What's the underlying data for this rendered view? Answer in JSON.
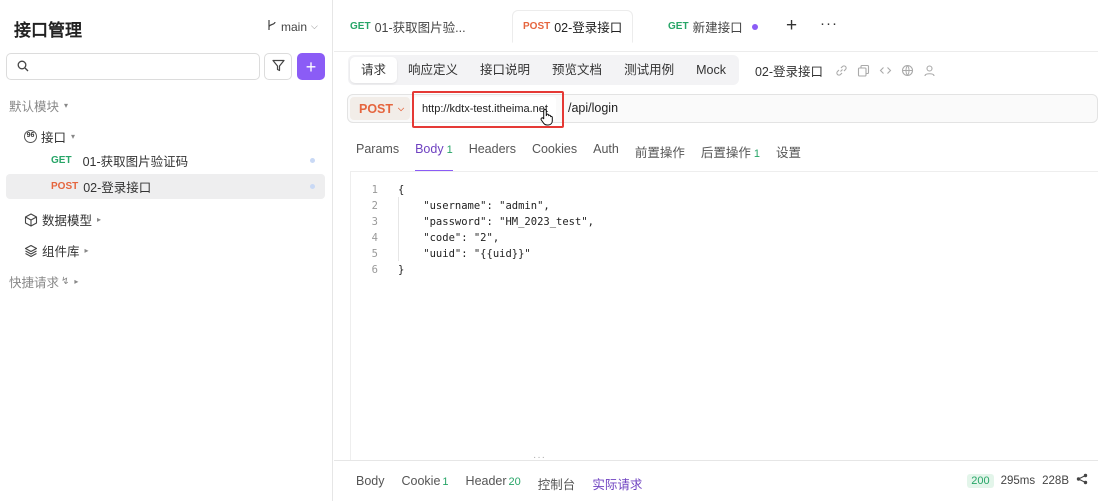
{
  "sidebar": {
    "title": "接口管理",
    "branch": "main",
    "add_label": "+",
    "module_label": "默认模块",
    "folder_label": "接口",
    "folder_icon_text": "96",
    "items": [
      {
        "method": "GET",
        "name": "01-获取图片验证码"
      },
      {
        "method": "POST",
        "name": "02-登录接口"
      }
    ],
    "data_model_label": "数据模型",
    "component_label": "组件库",
    "quick_request_label": "快捷请求",
    "quick_request_icon": "↯"
  },
  "tabs": [
    {
      "method": "GET",
      "label": "01-获取图片验..."
    },
    {
      "method": "POST",
      "label": "02-登录接口"
    },
    {
      "method": "GET",
      "label": "新建接口"
    }
  ],
  "subtoolbar": {
    "segments": [
      "请求",
      "响应定义",
      "接口说明",
      "预览文档",
      "测试用例",
      "Mock"
    ],
    "api_name": "02-登录接口"
  },
  "url": {
    "method": "POST",
    "base": "http://kdtx-test.itheima.net",
    "path": "/api/login"
  },
  "request_tabs": {
    "params": "Params",
    "body": "Body",
    "body_count": "1",
    "headers": "Headers",
    "cookies": "Cookies",
    "auth": "Auth",
    "pre": "前置操作",
    "post": "后置操作",
    "post_count": "1",
    "settings": "设置"
  },
  "editor": {
    "lines": [
      {
        "n": "1",
        "text": "{"
      },
      {
        "n": "2",
        "text": "    \"username\": \"admin\","
      },
      {
        "n": "3",
        "text": "    \"password\": \"HM_2023_test\","
      },
      {
        "n": "4",
        "text": "    \"code\": \"2\","
      },
      {
        "n": "5",
        "text": "    \"uuid\": \"{{uid}}\""
      },
      {
        "n": "6",
        "text": "}"
      }
    ]
  },
  "response": {
    "body": "Body",
    "cookie": "Cookie",
    "cookie_count": "1",
    "header": "Header",
    "header_count": "20",
    "console": "控制台",
    "actual": "实际请求",
    "status": "200",
    "time": "295ms",
    "size": "228B"
  },
  "colors": {
    "accent": "#8b5cf6",
    "get": "#27a567",
    "post": "#e5653e",
    "highlight": "#e53935"
  }
}
